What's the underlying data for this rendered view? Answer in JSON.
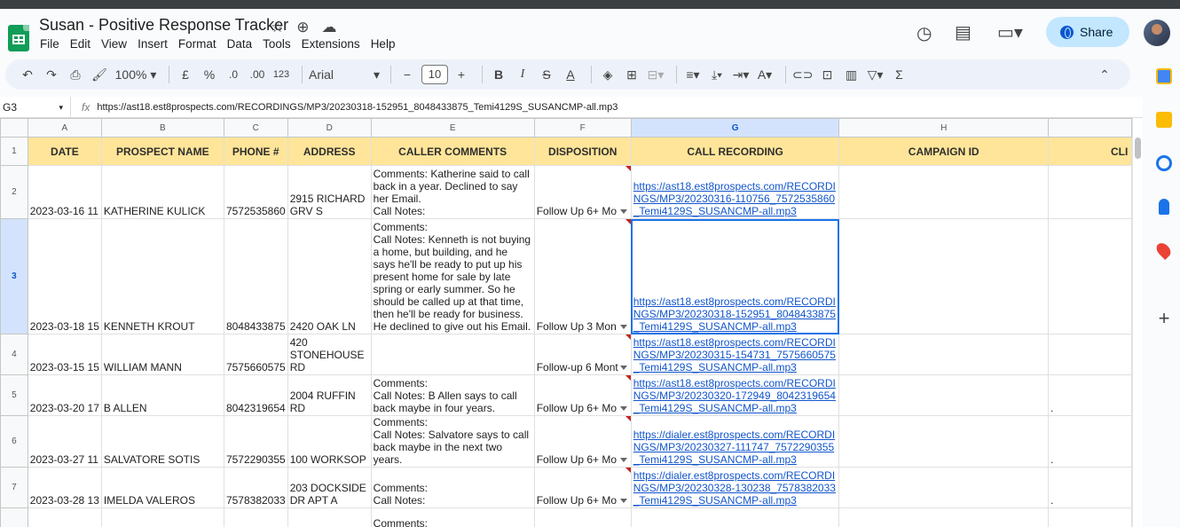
{
  "doc": {
    "title": "Susan - Positive Response Tracker"
  },
  "menu": [
    "File",
    "Edit",
    "View",
    "Insert",
    "Format",
    "Data",
    "Tools",
    "Extensions",
    "Help"
  ],
  "share_label": "Share",
  "toolbar": {
    "zoom": "100%",
    "currency": "£",
    "percent": "%",
    "dec_dec": ".0",
    "inc_dec": ".00",
    "numfmt": "123",
    "font": "Arial",
    "font_size": "10"
  },
  "formula_bar": {
    "cell": "G3",
    "fx": "fx",
    "value": "https://ast18.est8prospects.com/RECORDINGS/MP3/20230318-152951_8048433875_Temi4129S_SUSANCMP-all.mp3"
  },
  "columns": [
    "A",
    "B",
    "C",
    "D",
    "E",
    "F",
    "G",
    "H",
    ""
  ],
  "headers": [
    "DATE",
    "PROSPECT NAME",
    "PHONE #",
    "ADDRESS",
    "CALLER COMMENTS",
    "DISPOSITION",
    "CALL RECORDING",
    "CAMPAIGN ID",
    "CLI"
  ],
  "rows": [
    {
      "num": "2",
      "date": "2023-03-16 11",
      "name": "KATHERINE KULICK",
      "phone": "7572535860",
      "address": "2915 RICHARD GRV S",
      "comments": "Comments: Katherine said to call back in a year. Declined to say her Email.\n Call Notes:",
      "disposition": "Follow Up 6+ Mo",
      "recording": "https://ast18.est8prospects.com/RECORDINGS/MP3/20230316-110756_7572535860_Temi4129S_SUSANCMP-all.mp3",
      "campaign": "",
      "extra": ""
    },
    {
      "num": "3",
      "date": "2023-03-18 15",
      "name": "KENNETH KROUT",
      "phone": "8048433875",
      "address": "2420 OAK LN",
      "comments": "Comments:\n Call Notes: Kenneth is not buying a home, but building, and he says he'll be ready to put up his present home for sale by late spring or early summer. So he should be called up at that time, then he'll be ready for business. He declined to give out his Email.",
      "disposition": "Follow Up 3 Mon",
      "recording": "https://ast18.est8prospects.com/RECORDINGS/MP3/20230318-152951_8048433875_Temi4129S_SUSANCMP-all.mp3",
      "campaign": "",
      "extra": ""
    },
    {
      "num": "4",
      "date": "2023-03-15 15",
      "name": "WILLIAM MANN",
      "phone": "7575660575",
      "address": "420 STONEHOUSE RD",
      "comments": "",
      "disposition": "Follow-up 6 Mont",
      "recording": "https://ast18.est8prospects.com/RECORDINGS/MP3/20230315-154731_7575660575_Temi4129S_SUSANCMP-all.mp3",
      "campaign": "",
      "extra": ""
    },
    {
      "num": "5",
      "date": "2023-03-20 17",
      "name": "B ALLEN",
      "phone": "8042319654",
      "address": "2004 RUFFIN RD",
      "comments": "Comments:\n Call Notes: B Allen says to call back maybe in four years.",
      "disposition": "Follow Up 6+ Mo",
      "recording": "https://ast18.est8prospects.com/RECORDINGS/MP3/20230320-172949_8042319654_Temi4129S_SUSANCMP-all.mp3",
      "campaign": "",
      "extra": "."
    },
    {
      "num": "6",
      "date": "2023-03-27 11",
      "name": "SALVATORE SOTIS",
      "phone": "7572290355",
      "address": "100 WORKSOP",
      "comments": "Comments:\n Call Notes: Salvatore says to call back maybe in the next two years.",
      "disposition": "Follow Up 6+ Mo",
      "recording": "https://dialer.est8prospects.com/RECORDINGS/MP3/20230327-111747_7572290355_Temi4129S_SUSANCMP-all.mp3",
      "campaign": "",
      "extra": "."
    },
    {
      "num": "7",
      "date": "2023-03-28 13",
      "name": "IMELDA VALEROS",
      "phone": "7578382033",
      "address": "203 DOCKSIDE DR APT A",
      "comments": "Comments:\n Call Notes:",
      "disposition": "Follow Up 6+ Mo",
      "recording": "https://dialer.est8prospects.com/RECORDINGS/MP3/20230328-130238_7578382033_Temi4129S_SUSANCMP-all.mp3",
      "campaign": "",
      "extra": "."
    },
    {
      "num": "",
      "date": "",
      "name": "",
      "phone": "",
      "address": "",
      "comments": "Comments:\n Call Notes: Mrs Holmes asked to",
      "disposition": "",
      "recording": "",
      "campaign": "",
      "extra": ""
    }
  ]
}
